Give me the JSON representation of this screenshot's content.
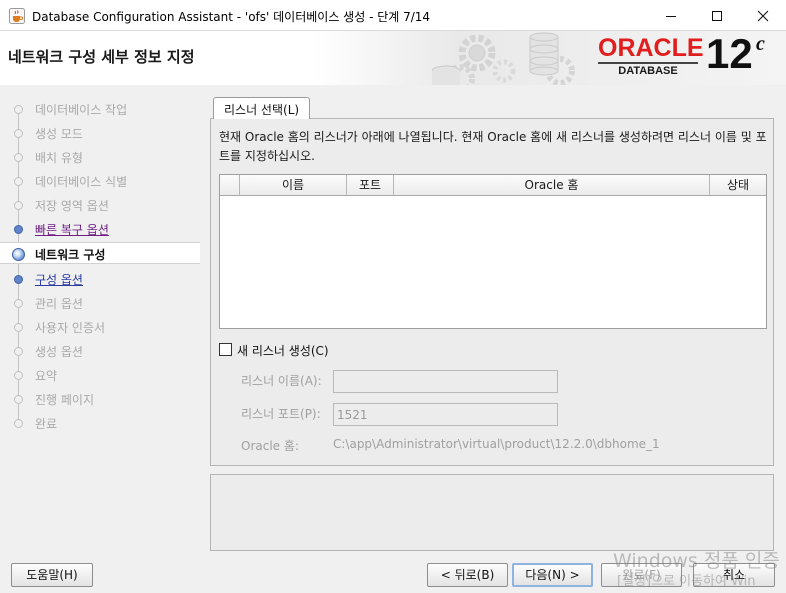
{
  "window": {
    "title": "Database Configuration Assistant - 'ofs' 데이터베이스 생성 - 단계 7/14",
    "icons": {
      "app": "java-cup-icon",
      "minimize": "minimize-icon",
      "maximize": "maximize-icon",
      "close": "close-icon"
    }
  },
  "header": {
    "title": "네트워크 구성 세부 정보 지정",
    "logo": {
      "brand": "ORACLE",
      "product": "DATABASE",
      "version": "12",
      "version_suffix": "c",
      "brand_color": "#e21d1d"
    }
  },
  "steps": [
    {
      "label": "데이터베이스 작업",
      "state": "disabled"
    },
    {
      "label": "생성 모드",
      "state": "disabled"
    },
    {
      "label": "배치 유형",
      "state": "disabled"
    },
    {
      "label": "데이터베이스 식별",
      "state": "disabled"
    },
    {
      "label": "저장 영역 옵션",
      "state": "disabled"
    },
    {
      "label": "빠른 복구 옵션",
      "state": "visited"
    },
    {
      "label": "네트워크 구성",
      "state": "current"
    },
    {
      "label": "구성 옵션",
      "state": "link"
    },
    {
      "label": "관리 옵션",
      "state": "disabled"
    },
    {
      "label": "사용자 인증서",
      "state": "disabled"
    },
    {
      "label": "생성 옵션",
      "state": "disabled"
    },
    {
      "label": "요약",
      "state": "disabled"
    },
    {
      "label": "진행 페이지",
      "state": "disabled"
    },
    {
      "label": "완료",
      "state": "disabled"
    }
  ],
  "tab": {
    "label": "리스너 선택(L)"
  },
  "description": "현재 Oracle 홈의 리스너가 아래에 나열됩니다. 현재 Oracle 홈에 새 리스너를 생성하려면 리스너 이름 및 포트를 지정하십시오.",
  "listener_table": {
    "columns": [
      "",
      "이름",
      "포트",
      "Oracle 홈",
      "상태"
    ],
    "rows": []
  },
  "new_listener": {
    "checkbox_label": "새 리스너 생성(C)",
    "checked": false,
    "name_label": "리스너 이름(A):",
    "name_value": "",
    "port_label": "리스너 포트(P):",
    "port_value": "1521",
    "oracle_home_label": "Oracle 홈:",
    "oracle_home_value": "C:\\app\\Administrator\\virtual\\product\\12.2.0\\dbhome_1"
  },
  "buttons": {
    "help": "도움말(H)",
    "back": "< 뒤로(B)",
    "next": "다음(N) >",
    "finish": "완료(F)",
    "cancel": "취소"
  },
  "watermark": {
    "line1": "Windows 정품 인증",
    "line2": "[설정]으로 이동하여 Win"
  }
}
